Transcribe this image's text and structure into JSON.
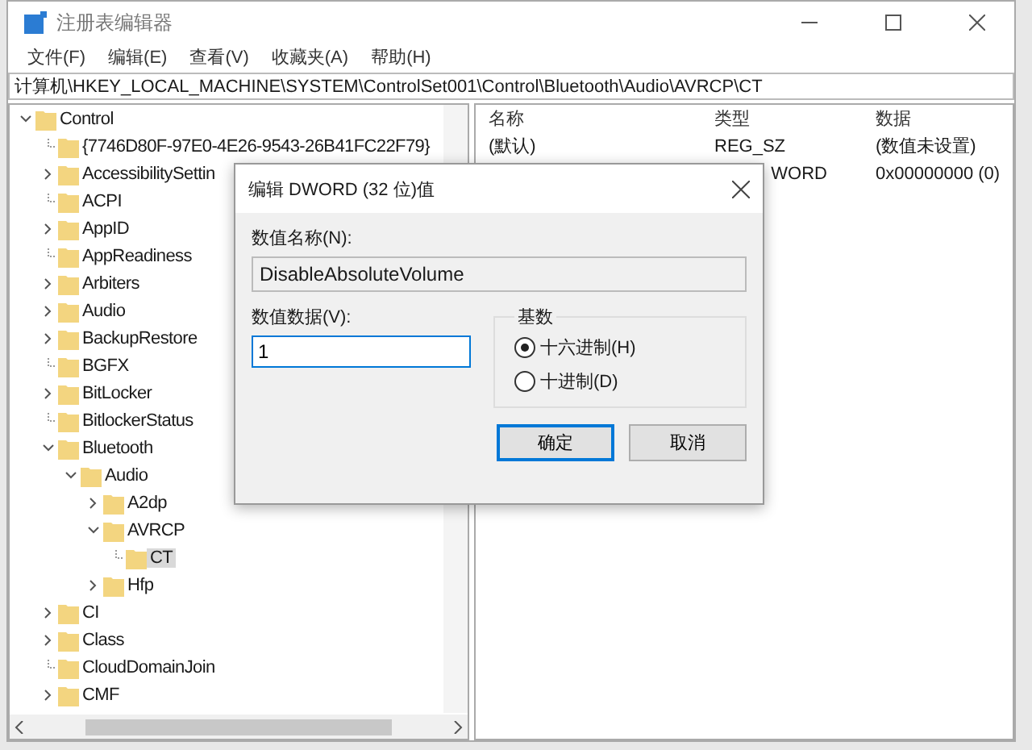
{
  "window": {
    "title": "注册表编辑器"
  },
  "menu": [
    "文件(F)",
    "编辑(E)",
    "查看(V)",
    "收藏夹(A)",
    "帮助(H)"
  ],
  "address": "计算机\\HKEY_LOCAL_MACHINE\\SYSTEM\\ControlSet001\\Control\\Bluetooth\\Audio\\AVRCP\\CT",
  "tree": [
    {
      "label": "Control",
      "kind": "branch",
      "expanded": true,
      "selected": false,
      "children": [
        {
          "label": "{7746D80F-97E0-4E26-9543-26B41FC22F79}",
          "kind": "leaf",
          "selected": false
        },
        {
          "label": "AccessibilitySettin",
          "kind": "branch",
          "expanded": false,
          "selected": false
        },
        {
          "label": "ACPI",
          "kind": "leaf",
          "selected": false
        },
        {
          "label": "AppID",
          "kind": "branch",
          "expanded": false,
          "selected": false
        },
        {
          "label": "AppReadiness",
          "kind": "leaf",
          "selected": false
        },
        {
          "label": "Arbiters",
          "kind": "branch",
          "expanded": false,
          "selected": false
        },
        {
          "label": "Audio",
          "kind": "branch",
          "expanded": false,
          "selected": false
        },
        {
          "label": "BackupRestore",
          "kind": "branch",
          "expanded": false,
          "selected": false
        },
        {
          "label": "BGFX",
          "kind": "leaf",
          "selected": false
        },
        {
          "label": "BitLocker",
          "kind": "branch",
          "expanded": false,
          "selected": false
        },
        {
          "label": "BitlockerStatus",
          "kind": "leaf",
          "selected": false
        },
        {
          "label": "Bluetooth",
          "kind": "branch",
          "expanded": true,
          "selected": false,
          "children": [
            {
              "label": "Audio",
              "kind": "branch",
              "expanded": true,
              "selected": false,
              "children": [
                {
                  "label": "A2dp",
                  "kind": "branch",
                  "expanded": false,
                  "selected": false
                },
                {
                  "label": "AVRCP",
                  "kind": "branch",
                  "expanded": true,
                  "selected": false,
                  "children": [
                    {
                      "label": "CT",
                      "kind": "leaf",
                      "selected": true
                    }
                  ]
                },
                {
                  "label": "Hfp",
                  "kind": "branch",
                  "expanded": false,
                  "selected": false
                }
              ]
            }
          ]
        },
        {
          "label": "CI",
          "kind": "branch",
          "expanded": false,
          "selected": false
        },
        {
          "label": "Class",
          "kind": "branch",
          "expanded": false,
          "selected": false
        },
        {
          "label": "CloudDomainJoin",
          "kind": "leaf",
          "selected": false
        },
        {
          "label": "CMF",
          "kind": "branch",
          "expanded": false,
          "selected": false
        }
      ]
    }
  ],
  "list": {
    "columns": [
      "名称",
      "类型",
      "数据"
    ],
    "rows": [
      {
        "name": "(默认)",
        "type": "REG_SZ",
        "data": "(数值未设置)"
      },
      {
        "type": "WORD",
        "data": "0x00000000 (0)"
      }
    ]
  },
  "dialog": {
    "title": "编辑 DWORD (32 位)值",
    "name_label": "数值名称(N):",
    "name_value": "DisableAbsoluteVolume",
    "data_label": "数值数据(V):",
    "data_value": "1",
    "base_label": "基数",
    "bases": [
      {
        "label": "十六进制(H)",
        "selected": true
      },
      {
        "label": "十进制(D)",
        "selected": false
      }
    ],
    "buttons": [
      {
        "label": "确定",
        "default": true
      },
      {
        "label": "取消",
        "default": false
      }
    ]
  }
}
